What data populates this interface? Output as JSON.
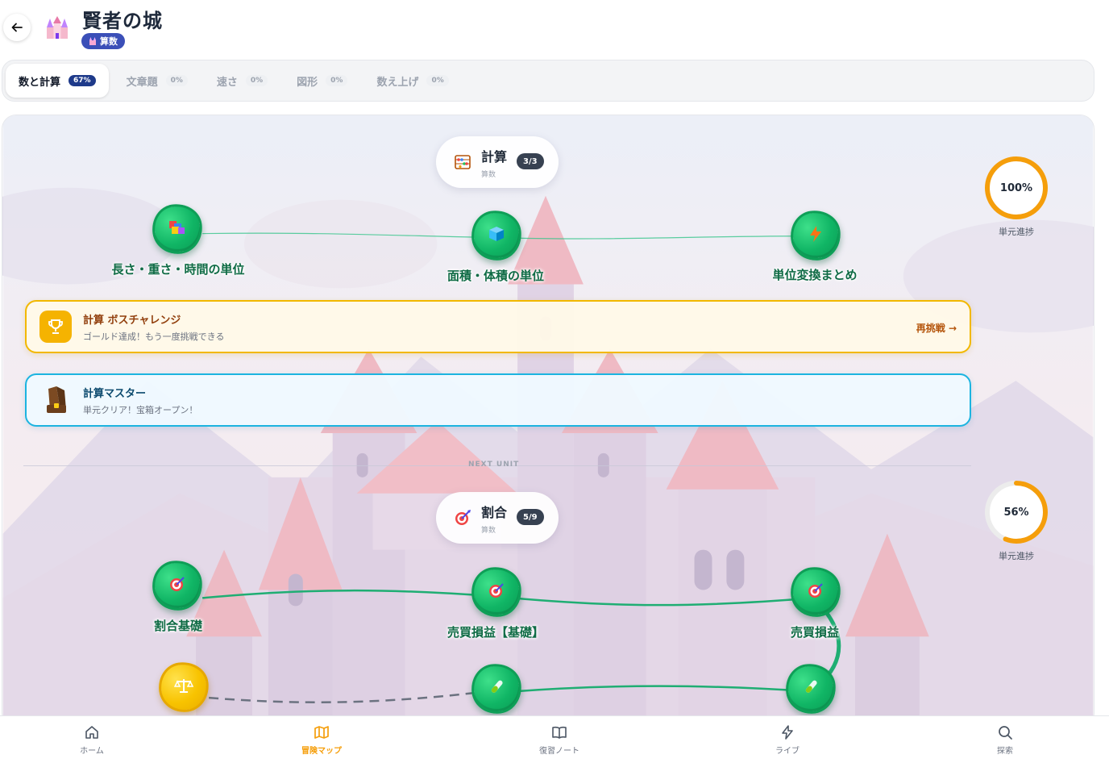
{
  "header": {
    "title": "賢者の城",
    "subject_badge": "算数"
  },
  "tabs": [
    {
      "label": "数と計算",
      "pct": "67%",
      "active": true
    },
    {
      "label": "文章題",
      "pct": "0%",
      "active": false
    },
    {
      "label": "速さ",
      "pct": "0%",
      "active": false
    },
    {
      "label": "図形",
      "pct": "0%",
      "active": false
    },
    {
      "label": "数え上げ",
      "pct": "0%",
      "active": false
    }
  ],
  "units": [
    {
      "name": "計算",
      "subject": "算数",
      "count": "3/3",
      "icon": "abacus-icon",
      "progress_pct": 100,
      "progress_text": "100%",
      "progress_label": "単元進捗",
      "nodes": [
        {
          "label": "長さ・重さ・時間の単位",
          "icon": "blocks-icon",
          "status": "cleared"
        },
        {
          "label": "面積・体積の単位",
          "icon": "cube-icon",
          "status": "cleared"
        },
        {
          "label": "単位変換まとめ",
          "icon": "lightning-icon",
          "status": "cleared"
        }
      ],
      "boss_banner": {
        "title": "計算 ボスチャレンジ",
        "subtitle": "ゴールド達成！もう一度挑戦できる",
        "action": "再挑戦 →",
        "icon": "trophy-icon"
      },
      "master_banner": {
        "title": "計算マスター",
        "subtitle": "単元クリア！宝箱オープン！",
        "icon": "treasure-chest-icon"
      }
    },
    {
      "name": "割合",
      "subject": "算数",
      "count": "5/9",
      "icon": "target-icon",
      "progress_pct": 56,
      "progress_text": "56%",
      "progress_label": "単元進捗",
      "nodes": [
        {
          "label": "割合基礎",
          "icon": "target-icon",
          "status": "cleared"
        },
        {
          "label": "売買損益【基礎】",
          "icon": "target-icon",
          "status": "cleared"
        },
        {
          "label": "売買損益",
          "icon": "target-icon",
          "status": "cleared"
        },
        {
          "label": "",
          "icon": "balance-scale-icon",
          "status": "current"
        },
        {
          "label": "",
          "icon": "test-tube-icon",
          "status": "cleared"
        },
        {
          "label": "",
          "icon": "test-tube-icon",
          "status": "cleared"
        }
      ]
    }
  ],
  "next_unit_label": "NEXT UNIT",
  "bottom_nav": [
    {
      "label": "ホーム",
      "icon": "home-icon",
      "active": false
    },
    {
      "label": "冒険マップ",
      "icon": "map-icon",
      "active": true
    },
    {
      "label": "復習ノート",
      "icon": "book-icon",
      "active": false
    },
    {
      "label": "ライブ",
      "icon": "lightning-icon",
      "active": false
    },
    {
      "label": "探索",
      "icon": "search-icon",
      "active": false
    }
  ],
  "colors": {
    "accent_blue": "#1e3a8a",
    "node_green": "#10b565",
    "gold": "#f5b301",
    "sky_blue": "#1cb4e0",
    "nav_active": "#f59e0b"
  }
}
